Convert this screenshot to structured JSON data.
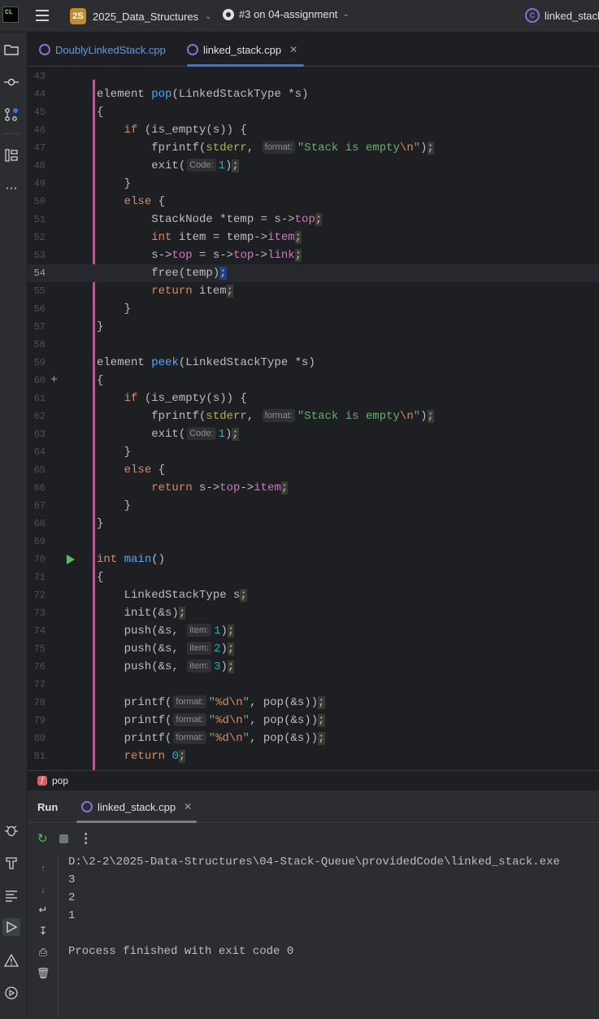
{
  "titlebar": {
    "logo_text": "CL",
    "project_badge": "2S",
    "project_name": "2025_Data_Structures",
    "branch": "#3 on 04-assignment",
    "run_config": "linked_stack.exe"
  },
  "editor_tabs": [
    {
      "label": "DoublyLinkedStack.cpp",
      "active": false
    },
    {
      "label": "linked_stack.cpp",
      "active": true
    }
  ],
  "code_lines": [
    {
      "n": "43"
    },
    {
      "n": "44"
    },
    {
      "n": "45"
    },
    {
      "n": "46"
    },
    {
      "n": "47"
    },
    {
      "n": "48"
    },
    {
      "n": "49"
    },
    {
      "n": "50"
    },
    {
      "n": "51"
    },
    {
      "n": "52"
    },
    {
      "n": "53"
    },
    {
      "n": "54"
    },
    {
      "n": "55"
    },
    {
      "n": "56"
    },
    {
      "n": "57"
    },
    {
      "n": "58"
    },
    {
      "n": "59"
    },
    {
      "n": "60"
    },
    {
      "n": "61"
    },
    {
      "n": "62"
    },
    {
      "n": "63"
    },
    {
      "n": "64"
    },
    {
      "n": "65"
    },
    {
      "n": "66"
    },
    {
      "n": "67"
    },
    {
      "n": "68"
    },
    {
      "n": "69"
    },
    {
      "n": "70"
    },
    {
      "n": "71"
    },
    {
      "n": "72"
    },
    {
      "n": "73"
    },
    {
      "n": "74"
    },
    {
      "n": "75"
    },
    {
      "n": "76"
    },
    {
      "n": "77"
    },
    {
      "n": "78"
    },
    {
      "n": "79"
    },
    {
      "n": "80"
    },
    {
      "n": "81"
    }
  ],
  "code_text": {
    "l44": [
      "element ",
      "pop",
      "(LinkedStackType *s)"
    ],
    "l45": "{",
    "l46": [
      "    ",
      "if",
      " (is_empty(s)) {"
    ],
    "l47": [
      "        fprintf(",
      "stderr",
      ", ",
      "format:",
      "\"Stack is empty",
      "\\n",
      "\"",
      ")",
      ";"
    ],
    "l48": [
      "        exit(",
      "Code:",
      "1",
      ")",
      ";"
    ],
    "l49": "    }",
    "l50": [
      "    ",
      "else",
      " {"
    ],
    "l51": [
      "        StackNode *temp = s->",
      "top",
      ";"
    ],
    "l52": [
      "        ",
      "int",
      " item = temp->",
      "item",
      ";"
    ],
    "l53": [
      "        s->",
      "top",
      " = s->",
      "top",
      "->",
      "link",
      ";"
    ],
    "l54": [
      "        free(temp)",
      ";"
    ],
    "l55": [
      "        ",
      "return",
      " item",
      ";"
    ],
    "l56": "    }",
    "l57": "}",
    "l59": [
      "element ",
      "peek",
      "(LinkedStackType *s)"
    ],
    "l60": "{",
    "l61": [
      "    ",
      "if",
      " (is_empty(s)) {"
    ],
    "l62": [
      "        fprintf(",
      "stderr",
      ", ",
      "format:",
      "\"Stack is empty",
      "\\n",
      "\"",
      ")",
      ";"
    ],
    "l63": [
      "        exit(",
      "Code:",
      "1",
      ")",
      ";"
    ],
    "l64": "    }",
    "l65": [
      "    ",
      "else",
      " {"
    ],
    "l66": [
      "        ",
      "return",
      " s->",
      "top",
      "->",
      "item",
      ";"
    ],
    "l67": "    }",
    "l68": "}",
    "l70": [
      "int",
      " ",
      "main",
      "()"
    ],
    "l71": "{",
    "l72": [
      "    LinkedStackType s",
      ";"
    ],
    "l73": [
      "    init(&s)",
      ";"
    ],
    "l74": [
      "    push(&s, ",
      "item:",
      "1",
      ")",
      ";"
    ],
    "l75": [
      "    push(&s, ",
      "item:",
      "2",
      ")",
      ";"
    ],
    "l76": [
      "    push(&s, ",
      "item:",
      "3",
      ")",
      ";"
    ],
    "l78": [
      "    printf(",
      "format:",
      "\"",
      "%d\\n",
      "\"",
      ", pop(&s))",
      ";"
    ],
    "l79": [
      "    printf(",
      "format:",
      "\"",
      "%d\\n",
      "\"",
      ", pop(&s))",
      ";"
    ],
    "l80": [
      "    printf(",
      "format:",
      "\"",
      "%d\\n",
      "\"",
      ", pop(&s))",
      ";"
    ],
    "l81": [
      "    ",
      "return",
      " ",
      "0",
      ";"
    ]
  },
  "breadcrumb": {
    "icon_text": "f",
    "label": "pop"
  },
  "run_panel": {
    "title": "Run",
    "tab_label": "linked_stack.cpp",
    "console_lines": [
      "D:\\2-2\\2025-Data-Structures\\04-Stack-Queue\\providedCode\\linked_stack.exe",
      "3",
      "2",
      "1",
      "",
      "Process finished with exit code 0"
    ]
  },
  "icons": {
    "left_toolbar": [
      "folder-icon",
      "commit-icon",
      "pull-requests-icon",
      "structure-icon",
      "more-icon",
      "debug-icon",
      "build-icon",
      "terminal-icon",
      "run-icon",
      "problems-icon",
      "services-icon"
    ],
    "accent": "#3574f0",
    "change_bar": "#b35a93"
  }
}
